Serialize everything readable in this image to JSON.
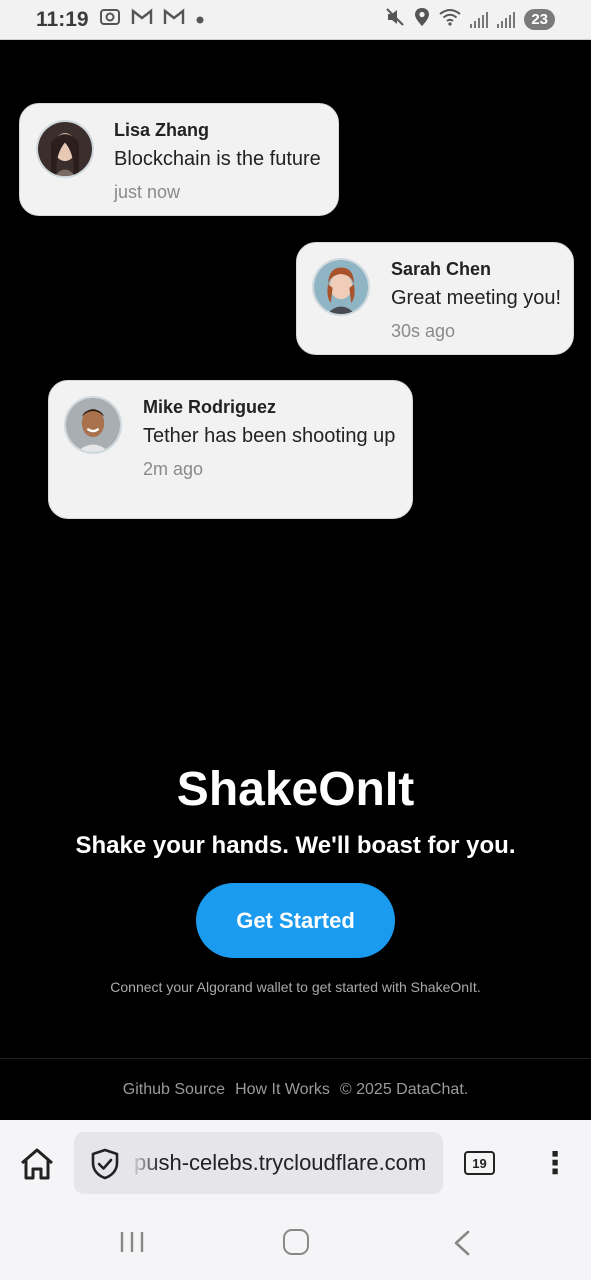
{
  "status_bar": {
    "time": "11:19",
    "battery": "23",
    "icons": [
      "screenshot-icon",
      "gmail-icon",
      "gmail-icon",
      "dot-icon",
      "mute-icon",
      "location-icon",
      "wifi-icon",
      "signal-icon",
      "signal-icon"
    ]
  },
  "messages": [
    {
      "name": "Lisa Zhang",
      "text": "Blockchain is the future",
      "time": "just now"
    },
    {
      "name": "Sarah Chen",
      "text": "Great meeting you!",
      "time": "30s ago"
    },
    {
      "name": "Mike Rodriguez",
      "text": "Tether has been shooting up",
      "time": "2m ago"
    }
  ],
  "hero": {
    "title": "ShakeOnIt",
    "tagline": "Shake your hands. We'll boast for you.",
    "cta_label": "Get Started",
    "hint": "Connect your Algorand wallet to get started with ShakeOnIt."
  },
  "footer": {
    "github": "Github Source",
    "how": "How It Works",
    "copyright": "© 2025 DataChat."
  },
  "browser": {
    "url": "push-celebs.trycloudflare.com",
    "tab_count": "19",
    "menu": "⋮"
  },
  "colors": {
    "accent": "#1a9bf0",
    "card_bg": "#f2f2f2",
    "page_bg": "#000000"
  }
}
